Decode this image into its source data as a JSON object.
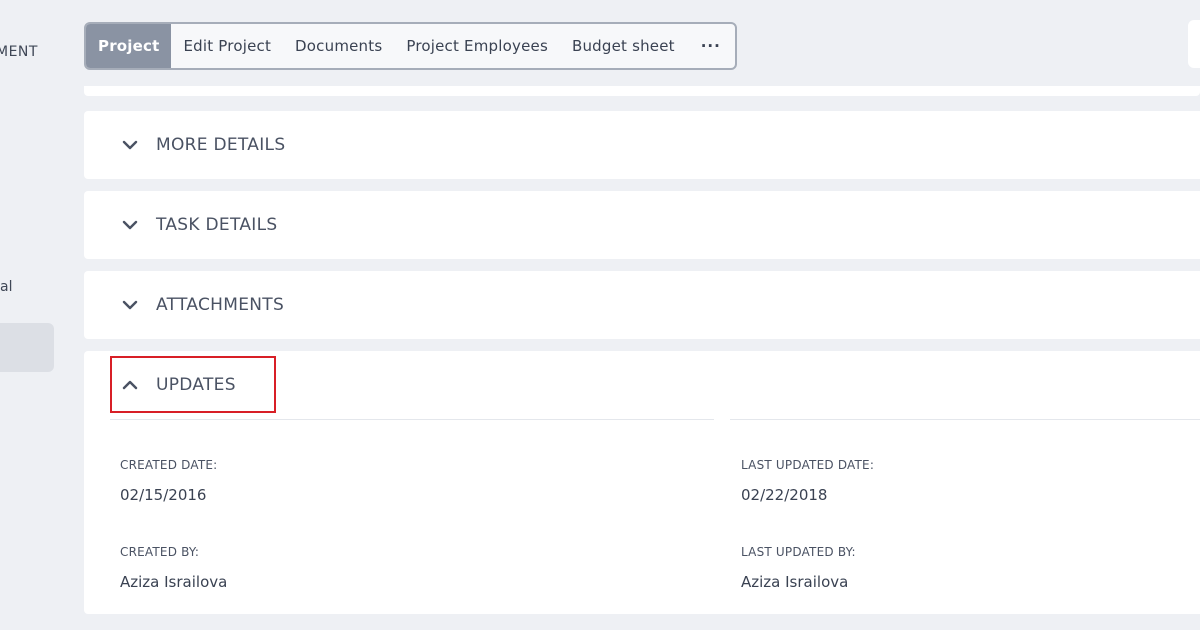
{
  "sidebar": {
    "heading_partial": "MENT",
    "item_partial": "al"
  },
  "tabs": [
    {
      "label": "Project",
      "active": true
    },
    {
      "label": "Edit Project",
      "active": false
    },
    {
      "label": "Documents",
      "active": false
    },
    {
      "label": "Project Employees",
      "active": false
    },
    {
      "label": "Budget sheet",
      "active": false
    },
    {
      "label": "···",
      "active": false
    }
  ],
  "sections": {
    "more_details": {
      "title": "MORE DETAILS",
      "icon": "chevron-down-icon",
      "expanded": false
    },
    "task_details": {
      "title": "TASK DETAILS",
      "icon": "chevron-down-icon",
      "expanded": false
    },
    "attachments": {
      "title": "ATTACHMENTS",
      "icon": "chevron-down-icon",
      "expanded": false
    },
    "updates": {
      "title": "UPDATES",
      "icon": "chevron-up-icon",
      "expanded": true
    }
  },
  "updates": {
    "created_date_label": "CREATED DATE:",
    "created_date_value": "02/15/2016",
    "last_updated_date_label": "LAST UPDATED DATE:",
    "last_updated_date_value": "02/22/2018",
    "created_by_label": "CREATED BY:",
    "created_by_value": "Aziza Israilova",
    "last_updated_by_label": "LAST UPDATED BY:",
    "last_updated_by_value": "Aziza Israilova"
  },
  "colors": {
    "background": "#eef0f4",
    "tab_active_bg": "#8a93a3",
    "highlight_border": "#d81f26",
    "text": "#3f4756"
  }
}
